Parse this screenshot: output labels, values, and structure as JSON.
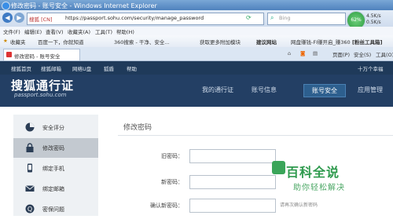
{
  "window": {
    "title": "修改密码 - 账号安全 - Windows Internet Explorer"
  },
  "address": {
    "security_label": "搜狐 [CN]",
    "url": "https://passport.sohu.com/security/manage_password",
    "search_engine": "Bing"
  },
  "speed_widget": {
    "percent": "62%",
    "up": "4.5K/s",
    "down": "0.5K/s"
  },
  "menu": [
    "文件(F)",
    "编辑(E)",
    "查看(V)",
    "收藏夹(A)",
    "工具(T)",
    "帮助(H)"
  ],
  "favorites": {
    "label": "收藏夹",
    "items": [
      "百度一下，你就知道",
      "360搜索 - 干净、安全...",
      "获取更多附加模块",
      "建议网站",
      "网盘赚钱-FI赚开启_赚360",
      "[粉丝工具箱]"
    ]
  },
  "tab": {
    "title": "修改密码 - 账号安全",
    "tools": [
      "页面(P)",
      "安全(S)",
      "工具(O)"
    ]
  },
  "topnav": {
    "items": [
      "搜狐首页",
      "搜狐邮箱",
      "网络U盘",
      "狐盾",
      "帮助"
    ],
    "user": "十万个幸福"
  },
  "header": {
    "logo": "搜狐通行证",
    "logo_sub": "passport.sohu.com",
    "tabs": [
      "我的通行证",
      "账号信息",
      "账号安全",
      "应用管理"
    ]
  },
  "sidebar": {
    "items": [
      "安全评分",
      "修改密码",
      "绑定手机",
      "绑定邮箱",
      "密保问题"
    ]
  },
  "form": {
    "title": "修改密码",
    "old_label": "旧密码：",
    "new_label": "新密码：",
    "confirm_label": "确认新密码：",
    "confirm_hint": "请再次确认新密码"
  },
  "watermark": {
    "title": "百科全说",
    "subtitle": "助你轻松解决"
  }
}
